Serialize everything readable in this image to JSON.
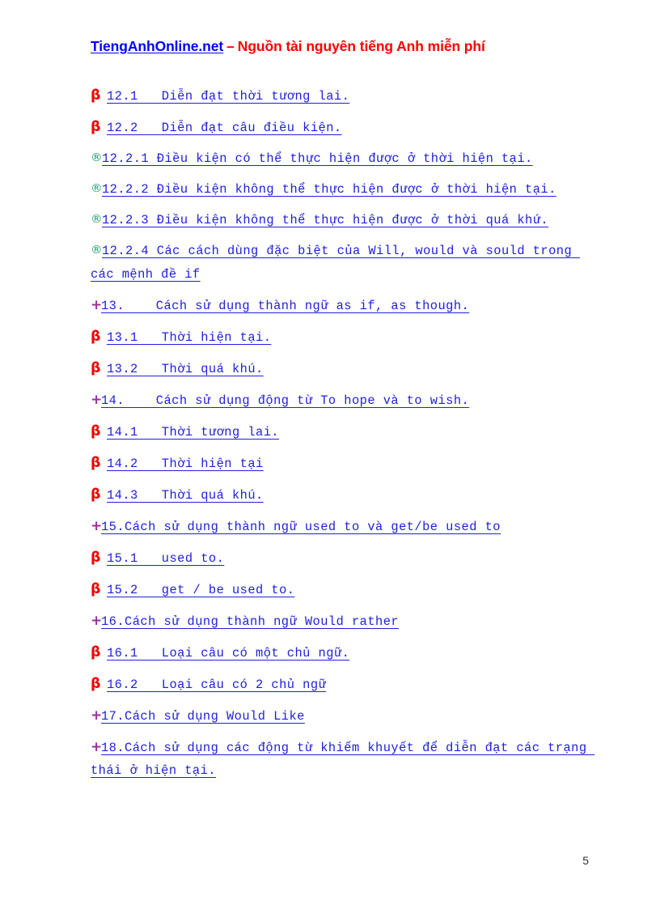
{
  "header": {
    "site_link": "TiengAnhOnline.net",
    "dash": "–",
    "tagline": "Nguồn tài nguyên tiếng Anh miễn phí",
    "link_color": "#0000ff",
    "tagline_color": "#ff0000"
  },
  "colors": {
    "text_blue": "#2020e0",
    "beta_red": "#ee0000",
    "reg_green": "#169c6b",
    "plus_purple": "#9b2f9b",
    "page_number": "#333333"
  },
  "toc": {
    "items": [
      {
        "marker": "β",
        "marker_kind": "beta",
        "text": "12.1   Diễn đạt thời tương lai."
      },
      {
        "marker": "β",
        "marker_kind": "beta",
        "text": "12.2   Diễn đạt câu điều kiện."
      },
      {
        "marker": "®",
        "marker_kind": "reg",
        "text": "12.2.1 Điều kiện có thể thực hiện được ở thời hiện tại."
      },
      {
        "marker": "®",
        "marker_kind": "reg",
        "text": "12.2.2 Điều kiện không thể thực hiện được ở thời hiện tại."
      },
      {
        "marker": "®",
        "marker_kind": "reg",
        "text": "12.2.3 Điều kiện không thể thực hiện được ở thời quá khứ."
      },
      {
        "marker": "®",
        "marker_kind": "reg",
        "text": "12.2.4 Các cách dùng đặc biệt của Will, would và sould trong các mệnh đề if"
      },
      {
        "marker": "+",
        "marker_kind": "plus",
        "text": "13.    Cách sử dụng thành ngữ as if, as though."
      },
      {
        "marker": "β",
        "marker_kind": "beta",
        "text": "13.1   Thời hiện tại."
      },
      {
        "marker": "β",
        "marker_kind": "beta",
        "text": "13.2   Thời quá khú."
      },
      {
        "marker": "+",
        "marker_kind": "plus",
        "text": "14.    Cách sử dụng động từ To hope và to wish."
      },
      {
        "marker": "β",
        "marker_kind": "beta",
        "text": "14.1   Thời tương lai."
      },
      {
        "marker": "β",
        "marker_kind": "beta",
        "text": "14.2   Thời hiện tại"
      },
      {
        "marker": "β",
        "marker_kind": "beta",
        "text": "14.3   Thời quá khú."
      },
      {
        "marker": "+",
        "marker_kind": "plus",
        "text": "15.Cách sử dụng thành ngữ used to và get/be used to"
      },
      {
        "marker": "β",
        "marker_kind": "beta",
        "text": "15.1   used to."
      },
      {
        "marker": "β",
        "marker_kind": "beta",
        "text": "15.2   get / be used to."
      },
      {
        "marker": "+",
        "marker_kind": "plus",
        "text": "16.Cách sử dụng thành ngữ Would rather"
      },
      {
        "marker": "β",
        "marker_kind": "beta",
        "text": "16.1   Loại câu có một chủ ngữ."
      },
      {
        "marker": "β",
        "marker_kind": "beta",
        "text": "16.2   Loại câu có 2 chủ ngữ"
      },
      {
        "marker": "+",
        "marker_kind": "plus",
        "text": "17.Cách sử dụng Would Like"
      },
      {
        "marker": "+",
        "marker_kind": "plus",
        "text": "18.Cách sử dụng các động từ khiếm khuyết để diễn đạt các trạng thái ở hiện tại."
      }
    ]
  },
  "footer": {
    "page_number": "5"
  }
}
